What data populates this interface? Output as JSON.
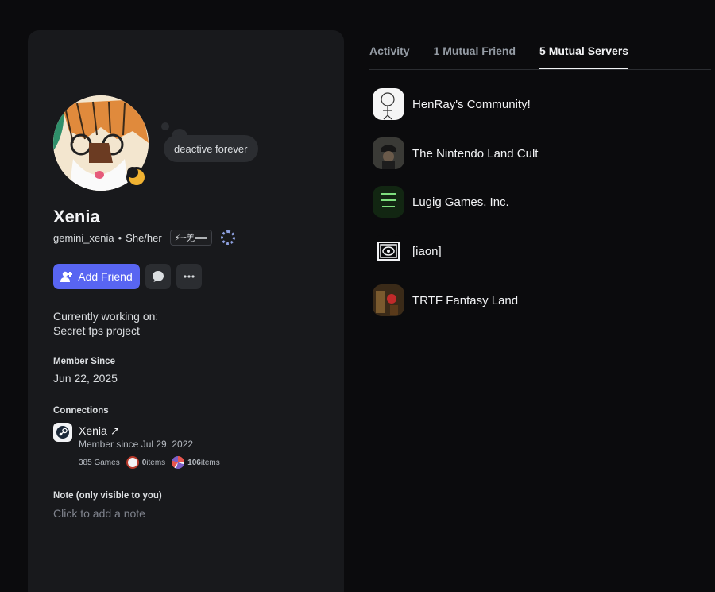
{
  "profile": {
    "display_name": "Xenia",
    "username": "gemini_xenia",
    "separator": "•",
    "pronouns": "She/her",
    "tag_text": "⚡╼羌══",
    "status_bubble": "deactive forever",
    "add_friend_label": "Add Friend",
    "about_line1": "Currently working on:",
    "about_line2": "Secret fps project",
    "member_since_title": "Member Since",
    "member_since_value": "Jun 22, 2025",
    "connections_title": "Connections",
    "connection": {
      "name": "Xenia ↗",
      "since": "Member since Jul 29, 2022",
      "games": "385 Games",
      "dota_count": "0",
      "dota_unit": " items",
      "tf_count": "106",
      "tf_unit": " items"
    },
    "note_title": "Note (only visible to you)",
    "note_placeholder": "Click to add a note"
  },
  "tabs": [
    {
      "label": "Activity",
      "active": false
    },
    {
      "label": "1 Mutual Friend",
      "active": false
    },
    {
      "label": "5 Mutual Servers",
      "active": true
    }
  ],
  "servers": [
    {
      "name": "HenRay's Community!",
      "icon": "henray-server-icon"
    },
    {
      "name": "The Nintendo Land Cult",
      "icon": "nintendo-land-server-icon"
    },
    {
      "name": "Lugig Games, Inc.",
      "icon": "lugig-games-server-icon"
    },
    {
      "name": "[iaon]",
      "icon": "iaon-server-icon"
    },
    {
      "name": "TRTF Fantasy Land",
      "icon": "trtf-server-icon"
    }
  ],
  "colors": {
    "accent": "#5865f2",
    "idle_status": "#f0b232",
    "card_bg": "#18191c",
    "page_bg": "#0b0b0d"
  }
}
